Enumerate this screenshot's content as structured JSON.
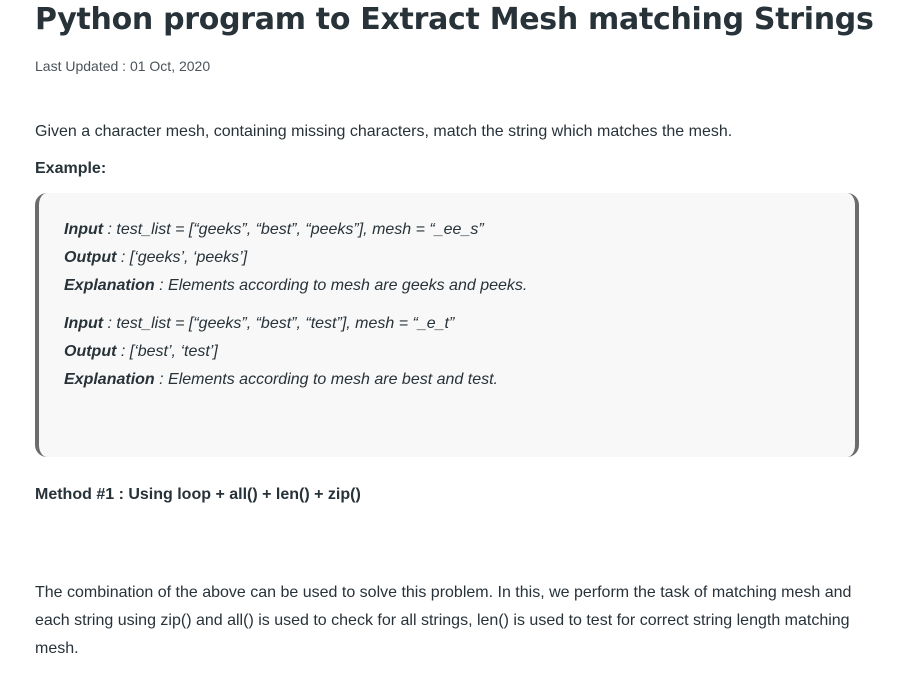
{
  "article": {
    "title": "Python program to Extract Mesh matching Strings",
    "last_updated_label": "Last Updated :",
    "last_updated_date": "01 Oct, 2020",
    "intro": "Given a character mesh, containing missing characters, match the string which matches the mesh.",
    "example_heading": "Example:",
    "examples": [
      {
        "input_key": "Input",
        "input_value": " : test_list = [“geeks”, “best”, “peeks”], mesh = “_ee_s”",
        "output_key": "Output",
        "output_value": " : [‘geeks’, ‘peeks’]",
        "explanation_key": "Explanation",
        "explanation_value": " : Elements according to mesh are geeks and peeks."
      },
      {
        "input_key": "Input",
        "input_value": " : test_list = [“geeks”, “best”, “test”], mesh = “_e_t”",
        "output_key": "Output",
        "output_value": " : [‘best’, ‘test’]",
        "explanation_key": "Explanation",
        "explanation_value": " : Elements according to mesh are best and test."
      }
    ],
    "method_heading": "Method #1 : Using loop + all() + len() + zip()",
    "method_paragraph": "The combination of the above can be used to solve this problem. In this, we perform the task of matching mesh and each string using zip() and all() is used to check for all strings, len() is used to test for correct string length matching mesh."
  }
}
